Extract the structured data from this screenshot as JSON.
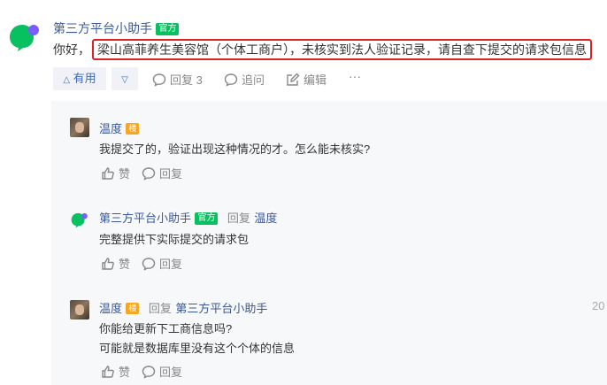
{
  "post": {
    "author": "第三方平台小助手",
    "badge": "官方",
    "prefix": "你好，",
    "highlight": "梁山高菲养生美容馆（个体工商户），未核实到法人验证记录，请自查下提交的请求包信息"
  },
  "actions": {
    "useful": "有用",
    "reply": "回复 3",
    "follow": "追问",
    "edit": "编辑",
    "more": "···"
  },
  "comments": [
    {
      "author": "温度",
      "floor_badge": "楼",
      "reply_label": "",
      "reply_to": "",
      "lines": [
        "我提交了的，验证出现这种情况的才。怎么能未核实?"
      ],
      "like": "赞",
      "reply": "回复"
    },
    {
      "author": "第三方平台小助手",
      "badge": "官方",
      "reply_label": "回复",
      "reply_to": "温度",
      "lines": [
        "完整提供下实际提交的请求包"
      ],
      "like": "赞",
      "reply": "回复"
    },
    {
      "author": "温度",
      "floor_badge": "楼",
      "reply_label": "回复",
      "reply_to": "第三方平台小助手",
      "lines": [
        "你能给更新下工商信息吗?",
        "可能就是数据库里没有这个个体的信息"
      ],
      "like": "赞",
      "reply": "回复",
      "date_fragment": "20"
    }
  ],
  "colors": {
    "brand_green": "#07c160",
    "link_blue": "#3b5998",
    "highlight_red": "#e02020",
    "floor_orange": "#f5a623"
  }
}
